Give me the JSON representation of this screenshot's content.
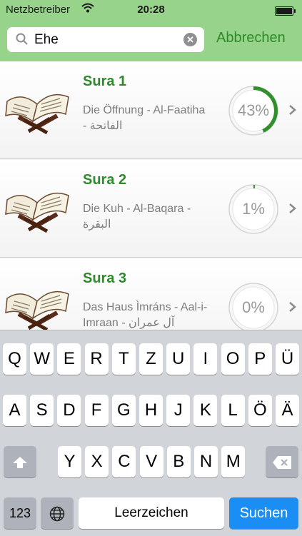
{
  "status_bar": {
    "carrier": "Netzbetreiber",
    "time": "20:28"
  },
  "search": {
    "value": "Ehe",
    "placeholder": "",
    "cancel_label": "Abbrechen"
  },
  "colors": {
    "accent_green": "#2e8a2a",
    "bar_green": "#97d38a",
    "progress_green": "#2f8f2a",
    "keyboard_blue": "#1a8ef5"
  },
  "suras": [
    {
      "title": "Sura 1",
      "subtitle_line1": "Die Öffnung - Al-Faatiha",
      "subtitle_line2": "- الفاتحة",
      "progress_label": "43%",
      "progress": 0.43
    },
    {
      "title": "Sura 2",
      "subtitle_line1": "Die Kuh - Al-Baqara -",
      "subtitle_line2": "البقرة",
      "progress_label": "1%",
      "progress": 0.01
    },
    {
      "title": "Sura 3",
      "subtitle_line1": "Das Haus Ìmráns - Aal-i-",
      "subtitle_line2": "Imraan - آل عمران",
      "progress_label": "0%",
      "progress": 0.0
    }
  ],
  "keyboard": {
    "row1": [
      "Q",
      "W",
      "E",
      "R",
      "T",
      "Z",
      "U",
      "I",
      "O",
      "P",
      "Ü"
    ],
    "row2": [
      "A",
      "S",
      "D",
      "F",
      "G",
      "H",
      "J",
      "K",
      "L",
      "Ö",
      "Ä"
    ],
    "row3": [
      "Y",
      "X",
      "C",
      "V",
      "B",
      "N",
      "M"
    ],
    "numbers_label": "123",
    "space_label": "Leerzeichen",
    "return_label": "Suchen",
    "icons": {
      "shift": "shift-arrow-icon",
      "backspace": "backspace-icon",
      "globe": "globe-icon"
    }
  }
}
